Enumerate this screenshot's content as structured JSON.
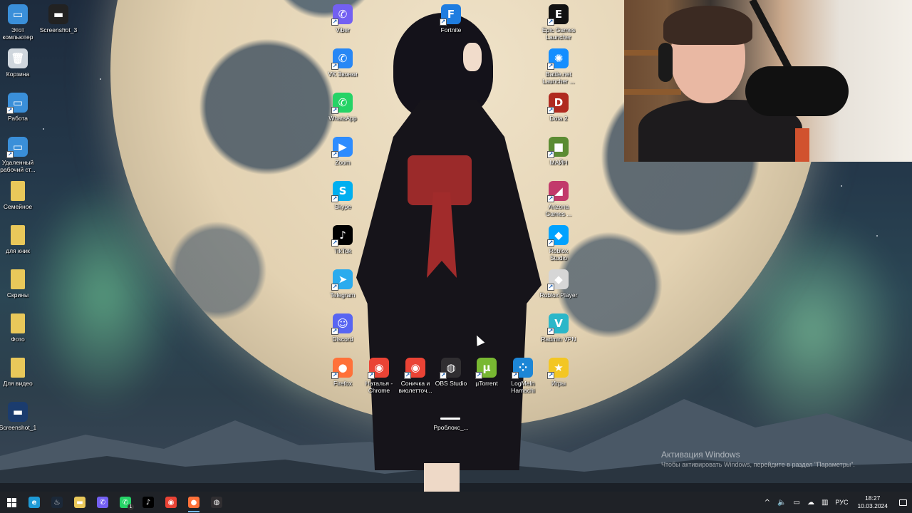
{
  "desktop": {
    "icons": [
      {
        "label": "Этот\nкомпьютер",
        "icon": "this-pc-icon",
        "color": "#3a8fd9",
        "glyph": "▭"
      },
      {
        "label": "Screenshot_3",
        "icon": "image-file-icon",
        "color": "#222222",
        "glyph": "▬"
      },
      {
        "label": "Корзина",
        "icon": "recycle-bin-icon",
        "color": "#cfd6dd",
        "glyph": "🗑"
      },
      {
        "label": "Работа",
        "icon": "computer-shortcut-icon",
        "color": "#3a8fd9",
        "glyph": "▭"
      },
      {
        "label": "Удаленный\nрабочий ст...",
        "icon": "remote-desktop-icon",
        "color": "#3a8fd9",
        "glyph": "▭"
      },
      {
        "label": "Семейное",
        "icon": "folder-icon",
        "color": "#e9c85a",
        "glyph": ""
      },
      {
        "label": "для кник",
        "icon": "folder-icon",
        "color": "#e9c85a",
        "glyph": ""
      },
      {
        "label": "Скрины",
        "icon": "folder-icon",
        "color": "#e9c85a",
        "glyph": ""
      },
      {
        "label": "Фото",
        "icon": "folder-icon",
        "color": "#e9c85a",
        "glyph": ""
      },
      {
        "label": "Для видео",
        "icon": "folder-icon",
        "color": "#e9c85a",
        "glyph": ""
      },
      {
        "label": "Screenshot_1",
        "icon": "image-file-icon",
        "color": "#1b3c6e",
        "glyph": "▬"
      },
      {
        "label": "Viber",
        "icon": "viber-icon",
        "color": "#7360f2",
        "glyph": "✆"
      },
      {
        "label": "VK Звонки",
        "icon": "vk-calls-icon",
        "color": "#2787f5",
        "glyph": "✆"
      },
      {
        "label": "WhatsApp",
        "icon": "whatsapp-icon",
        "color": "#25d366",
        "glyph": "✆"
      },
      {
        "label": "Zoom",
        "icon": "zoom-icon",
        "color": "#2d8cff",
        "glyph": "▶"
      },
      {
        "label": "Skype",
        "icon": "skype-icon",
        "color": "#00aff0",
        "glyph": "S"
      },
      {
        "label": "TikTok",
        "icon": "tiktok-icon",
        "color": "#000000",
        "glyph": "♪"
      },
      {
        "label": "Telegram",
        "icon": "telegram-icon",
        "color": "#2aabee",
        "glyph": "➤"
      },
      {
        "label": "Discord",
        "icon": "discord-icon",
        "color": "#5865f2",
        "glyph": "☺"
      },
      {
        "label": "Fortnite",
        "icon": "fortnite-icon",
        "color": "#1f7de0",
        "glyph": "F"
      },
      {
        "label": "Epic Games\nLauncher",
        "icon": "epic-games-icon",
        "color": "#121212",
        "glyph": "E"
      },
      {
        "label": "Battle.net\nLauncher ...",
        "icon": "battlenet-icon",
        "color": "#148eff",
        "glyph": "✺"
      },
      {
        "label": "Dota 2",
        "icon": "dota2-icon",
        "color": "#b02a20",
        "glyph": "D"
      },
      {
        "label": "МАЙН",
        "icon": "minecraft-icon",
        "color": "#5b8c33",
        "glyph": "■"
      },
      {
        "label": "Arizona\nGames ...",
        "icon": "arizona-games-icon",
        "color": "#c23a6b",
        "glyph": "◢"
      },
      {
        "label": "Roblox\nStudio",
        "icon": "roblox-studio-icon",
        "color": "#00a2ff",
        "glyph": "◆"
      },
      {
        "label": "Roblox Player",
        "icon": "roblox-player-icon",
        "color": "#d6d6d6",
        "glyph": "◆"
      },
      {
        "label": "Radmin VPN",
        "icon": "radmin-vpn-icon",
        "color": "#2bb7c9",
        "glyph": "V"
      },
      {
        "label": "Firefox",
        "icon": "firefox-icon",
        "color": "#ff7139",
        "glyph": "●"
      },
      {
        "label": "Наталья -\nChrome",
        "icon": "chrome-icon",
        "color": "#ea4335",
        "glyph": "◉"
      },
      {
        "label": "Соничка и\nвиолетточ...",
        "icon": "chrome-icon",
        "color": "#ea4335",
        "glyph": "◉"
      },
      {
        "label": "OBS Studio",
        "icon": "obs-icon",
        "color": "#302e31",
        "glyph": "◍"
      },
      {
        "label": "µTorrent",
        "icon": "utorrent-icon",
        "color": "#78b832",
        "glyph": "µ"
      },
      {
        "label": "LogMeIn\nHamachi",
        "icon": "hamachi-icon",
        "color": "#1d86d6",
        "glyph": "⁘"
      },
      {
        "label": "Игры",
        "icon": "star-icon",
        "color": "#f3c623",
        "glyph": "★"
      },
      {
        "label": "Рроблокс_...",
        "icon": "file-icon",
        "color": "#00000000",
        "glyph": ""
      }
    ]
  },
  "activation": {
    "title": "Активация Windows",
    "subtitle": "Чтобы активировать Windows, перейдите в раздел \"Параметры\"."
  },
  "taskbar": {
    "apps": [
      {
        "name": "edge-icon",
        "color": "#1e9ad6",
        "glyph": "e"
      },
      {
        "name": "steam-icon",
        "color": "#1b2838",
        "glyph": "♨"
      },
      {
        "name": "file-explorer-icon",
        "color": "#e9c85a",
        "glyph": "▬"
      },
      {
        "name": "viber-icon",
        "color": "#7360f2",
        "glyph": "✆"
      },
      {
        "name": "whatsapp-icon",
        "color": "#25d366",
        "glyph": "✆"
      },
      {
        "name": "tiktok-icon",
        "color": "#000000",
        "glyph": "♪"
      },
      {
        "name": "chrome-icon",
        "color": "#ea4335",
        "glyph": "◉"
      },
      {
        "name": "firefox-icon",
        "color": "#ff7139",
        "glyph": "●"
      },
      {
        "name": "obs-icon",
        "color": "#302e31",
        "glyph": "◍"
      }
    ],
    "whatsapp_badge": "1",
    "tray": {
      "chevron": "^",
      "language": "РУС",
      "time": "18:27",
      "date": "10.03.2024"
    }
  }
}
